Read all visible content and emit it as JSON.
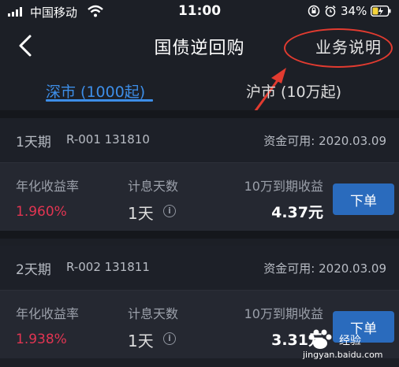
{
  "status_bar": {
    "carrier": "中国移动",
    "time": "11:00",
    "battery": "34%"
  },
  "nav": {
    "title": "国债逆回购",
    "help": "业务说明"
  },
  "tabs": [
    {
      "label": "深市 (1000起)"
    },
    {
      "label": "沪市 (10万起)"
    }
  ],
  "labels": {
    "rate": "年化收益率",
    "days": "计息天数",
    "profit": "10万到期收益",
    "order": "下单",
    "info": "i"
  },
  "cards": [
    {
      "term": "1天期",
      "code": "R-001  131810",
      "avail": "资金可用: 2020.03.09",
      "rate": "1.960%",
      "days": "1天",
      "profit": "4.37元"
    },
    {
      "term": "2天期",
      "code": "R-002  131811",
      "avail": "资金可用: 2020.03.09",
      "rate": "1.938%",
      "days": "1天",
      "profit": "3.31元"
    }
  ],
  "watermark": {
    "text": "经验",
    "url": "jingyan.baidu.com"
  },
  "colors": {
    "accent": "#3d8ee8",
    "rate": "#e23552",
    "annotation": "#e23b30",
    "button": "#2a6bbd"
  }
}
